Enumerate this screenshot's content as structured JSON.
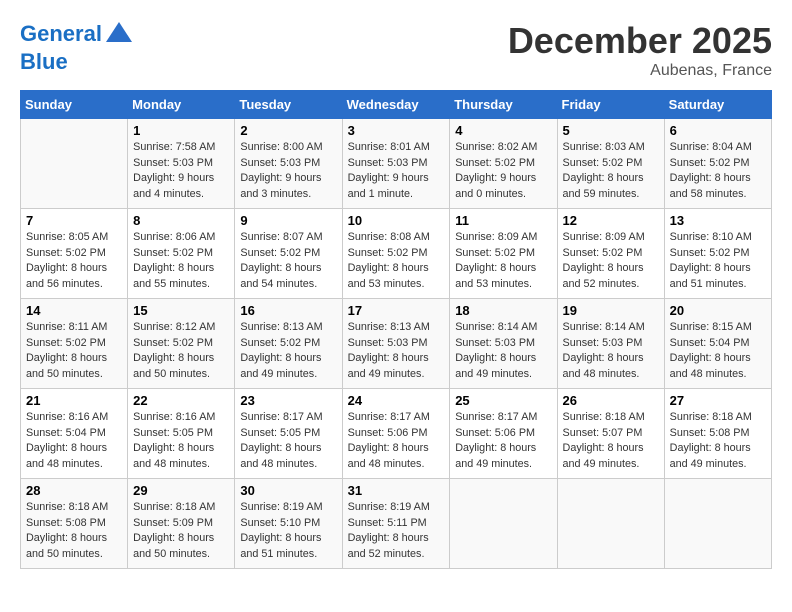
{
  "header": {
    "logo_line1": "General",
    "logo_line2": "Blue",
    "month": "December 2025",
    "location": "Aubenas, France"
  },
  "weekdays": [
    "Sunday",
    "Monday",
    "Tuesday",
    "Wednesday",
    "Thursday",
    "Friday",
    "Saturday"
  ],
  "weeks": [
    [
      {
        "day": "",
        "info": ""
      },
      {
        "day": "1",
        "info": "Sunrise: 7:58 AM\nSunset: 5:03 PM\nDaylight: 9 hours\nand 4 minutes."
      },
      {
        "day": "2",
        "info": "Sunrise: 8:00 AM\nSunset: 5:03 PM\nDaylight: 9 hours\nand 3 minutes."
      },
      {
        "day": "3",
        "info": "Sunrise: 8:01 AM\nSunset: 5:03 PM\nDaylight: 9 hours\nand 1 minute."
      },
      {
        "day": "4",
        "info": "Sunrise: 8:02 AM\nSunset: 5:02 PM\nDaylight: 9 hours\nand 0 minutes."
      },
      {
        "day": "5",
        "info": "Sunrise: 8:03 AM\nSunset: 5:02 PM\nDaylight: 8 hours\nand 59 minutes."
      },
      {
        "day": "6",
        "info": "Sunrise: 8:04 AM\nSunset: 5:02 PM\nDaylight: 8 hours\nand 58 minutes."
      }
    ],
    [
      {
        "day": "7",
        "info": "Sunrise: 8:05 AM\nSunset: 5:02 PM\nDaylight: 8 hours\nand 56 minutes."
      },
      {
        "day": "8",
        "info": "Sunrise: 8:06 AM\nSunset: 5:02 PM\nDaylight: 8 hours\nand 55 minutes."
      },
      {
        "day": "9",
        "info": "Sunrise: 8:07 AM\nSunset: 5:02 PM\nDaylight: 8 hours\nand 54 minutes."
      },
      {
        "day": "10",
        "info": "Sunrise: 8:08 AM\nSunset: 5:02 PM\nDaylight: 8 hours\nand 53 minutes."
      },
      {
        "day": "11",
        "info": "Sunrise: 8:09 AM\nSunset: 5:02 PM\nDaylight: 8 hours\nand 53 minutes."
      },
      {
        "day": "12",
        "info": "Sunrise: 8:09 AM\nSunset: 5:02 PM\nDaylight: 8 hours\nand 52 minutes."
      },
      {
        "day": "13",
        "info": "Sunrise: 8:10 AM\nSunset: 5:02 PM\nDaylight: 8 hours\nand 51 minutes."
      }
    ],
    [
      {
        "day": "14",
        "info": "Sunrise: 8:11 AM\nSunset: 5:02 PM\nDaylight: 8 hours\nand 50 minutes."
      },
      {
        "day": "15",
        "info": "Sunrise: 8:12 AM\nSunset: 5:02 PM\nDaylight: 8 hours\nand 50 minutes."
      },
      {
        "day": "16",
        "info": "Sunrise: 8:13 AM\nSunset: 5:02 PM\nDaylight: 8 hours\nand 49 minutes."
      },
      {
        "day": "17",
        "info": "Sunrise: 8:13 AM\nSunset: 5:03 PM\nDaylight: 8 hours\nand 49 minutes."
      },
      {
        "day": "18",
        "info": "Sunrise: 8:14 AM\nSunset: 5:03 PM\nDaylight: 8 hours\nand 49 minutes."
      },
      {
        "day": "19",
        "info": "Sunrise: 8:14 AM\nSunset: 5:03 PM\nDaylight: 8 hours\nand 48 minutes."
      },
      {
        "day": "20",
        "info": "Sunrise: 8:15 AM\nSunset: 5:04 PM\nDaylight: 8 hours\nand 48 minutes."
      }
    ],
    [
      {
        "day": "21",
        "info": "Sunrise: 8:16 AM\nSunset: 5:04 PM\nDaylight: 8 hours\nand 48 minutes."
      },
      {
        "day": "22",
        "info": "Sunrise: 8:16 AM\nSunset: 5:05 PM\nDaylight: 8 hours\nand 48 minutes."
      },
      {
        "day": "23",
        "info": "Sunrise: 8:17 AM\nSunset: 5:05 PM\nDaylight: 8 hours\nand 48 minutes."
      },
      {
        "day": "24",
        "info": "Sunrise: 8:17 AM\nSunset: 5:06 PM\nDaylight: 8 hours\nand 48 minutes."
      },
      {
        "day": "25",
        "info": "Sunrise: 8:17 AM\nSunset: 5:06 PM\nDaylight: 8 hours\nand 49 minutes."
      },
      {
        "day": "26",
        "info": "Sunrise: 8:18 AM\nSunset: 5:07 PM\nDaylight: 8 hours\nand 49 minutes."
      },
      {
        "day": "27",
        "info": "Sunrise: 8:18 AM\nSunset: 5:08 PM\nDaylight: 8 hours\nand 49 minutes."
      }
    ],
    [
      {
        "day": "28",
        "info": "Sunrise: 8:18 AM\nSunset: 5:08 PM\nDaylight: 8 hours\nand 50 minutes."
      },
      {
        "day": "29",
        "info": "Sunrise: 8:18 AM\nSunset: 5:09 PM\nDaylight: 8 hours\nand 50 minutes."
      },
      {
        "day": "30",
        "info": "Sunrise: 8:19 AM\nSunset: 5:10 PM\nDaylight: 8 hours\nand 51 minutes."
      },
      {
        "day": "31",
        "info": "Sunrise: 8:19 AM\nSunset: 5:11 PM\nDaylight: 8 hours\nand 52 minutes."
      },
      {
        "day": "",
        "info": ""
      },
      {
        "day": "",
        "info": ""
      },
      {
        "day": "",
        "info": ""
      }
    ]
  ]
}
